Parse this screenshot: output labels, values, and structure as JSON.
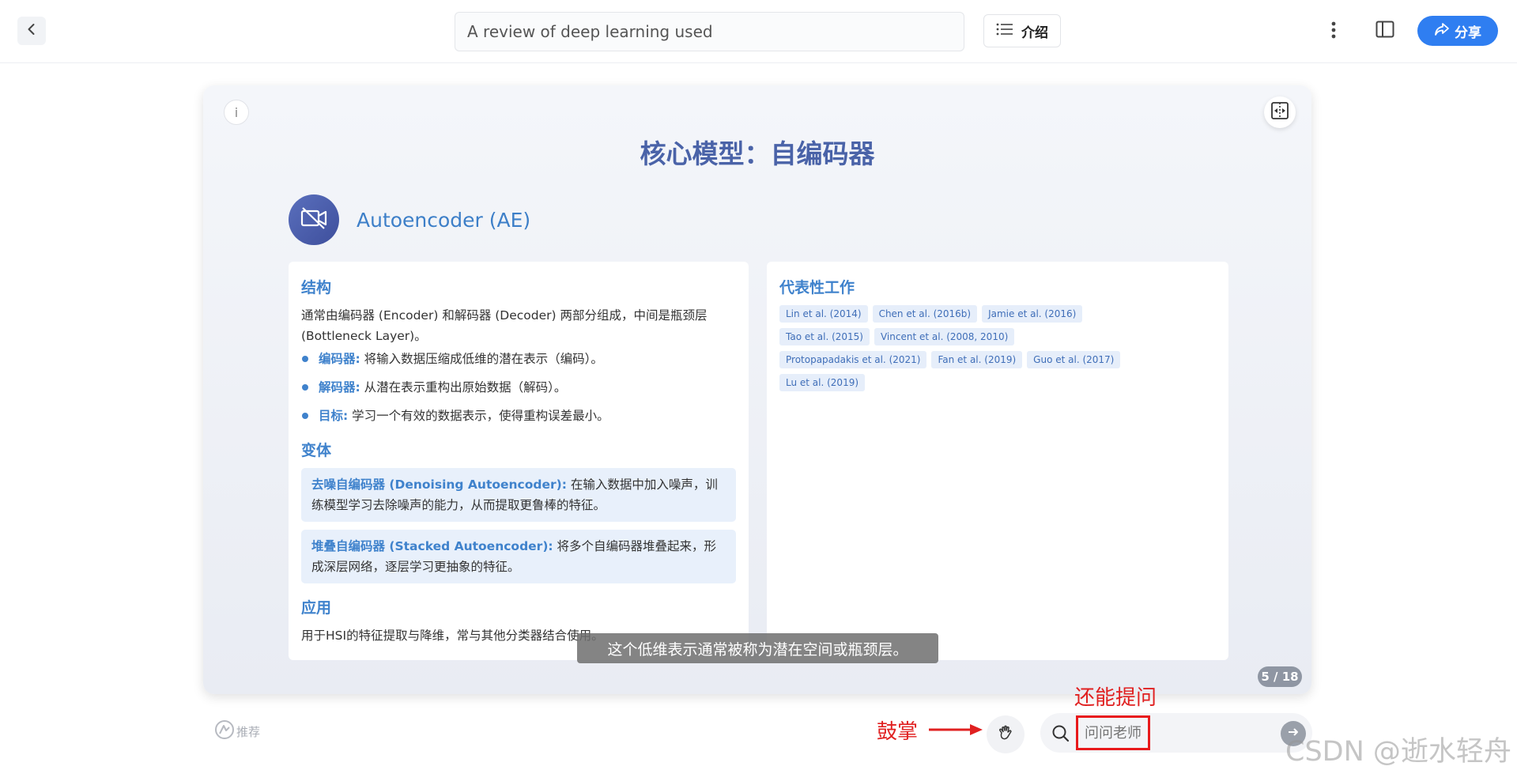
{
  "header": {
    "title_value": "A review of deep learning used",
    "intro_label": "介绍",
    "share_label": "分享"
  },
  "slide": {
    "title": "核心模型：自编码器",
    "model_name": "Autoencoder (AE)",
    "structure": {
      "heading": "结构",
      "description": "通常由编码器 (Encoder) 和解码器 (Decoder) 两部分组成，中间是瓶颈层 (Bottleneck Layer)。",
      "items": [
        {
          "key": "编码器:",
          "text": " 将输入数据压缩成低维的潜在表示（编码）。"
        },
        {
          "key": "解码器:",
          "text": " 从潜在表示重构出原始数据（解码）。"
        },
        {
          "key": "目标:",
          "text": " 学习一个有效的数据表示，使得重构误差最小。"
        }
      ]
    },
    "variants": {
      "heading": "变体",
      "items": [
        {
          "key": "去噪自编码器 (Denoising Autoencoder):",
          "text": " 在输入数据中加入噪声，训练模型学习去除噪声的能力，从而提取更鲁棒的特征。"
        },
        {
          "key": "堆叠自编码器 (Stacked Autoencoder):",
          "text": " 将多个自编码器堆叠起来，形成深层网络，逐层学习更抽象的特征。"
        }
      ]
    },
    "application": {
      "heading": "应用",
      "text": "用于HSI的特征提取与降维，常与其他分类器结合使用。"
    },
    "representative": {
      "heading": "代表性工作",
      "tags": [
        "Lin et al. (2014)",
        "Chen et al. (2016b)",
        "Jamie et al. (2016)",
        "Tao et al. (2015)",
        "Vincent et al. (2008, 2010)",
        "Protopapadakis et al. (2021)",
        "Fan et al. (2019)",
        "Guo et al. (2017)",
        "Lu et al. (2019)"
      ]
    },
    "subtitle": "这个低维表示通常被称为潜在空间或瓶颈层。",
    "page_indicator": "5 / 18"
  },
  "bottom": {
    "recommend_label": "推荐",
    "clap_annotation": "鼓掌",
    "ask_annotation": "还能提问",
    "ask_placeholder": "问问老师"
  },
  "watermark": "CSDN @逝水轻舟",
  "colors": {
    "accent": "#3f82cc",
    "share_button": "#2f7ef1",
    "annotation_red": "#e02020"
  }
}
